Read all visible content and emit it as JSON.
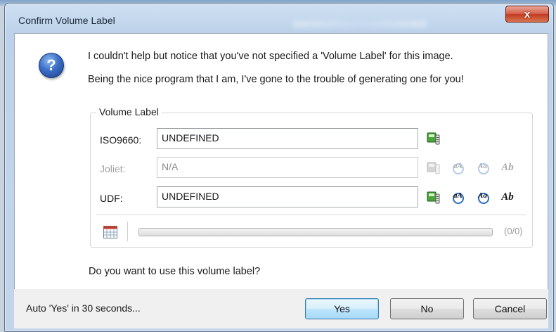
{
  "dialog": {
    "title": "Confirm Volume Label",
    "close_label": "x"
  },
  "message": {
    "line1": "I couldn't help but notice that you've not specified a 'Volume Label' for this image.",
    "line2": "Being the nice program that I am, I've gone to the trouble of generating one for you!"
  },
  "volume_group": {
    "label": "Volume Label",
    "iso9660": {
      "label": "ISO9660:",
      "value": "UNDEFINED",
      "enabled": true
    },
    "joliet": {
      "label": "Joliet:",
      "value": "N/A",
      "enabled": false
    },
    "udf": {
      "label": "UDF:",
      "value": "UNDEFINED",
      "enabled": true
    },
    "style_icons": [
      "lowercase-a-icon",
      "capital-a-icon",
      "ab-icon"
    ],
    "progress": {
      "text": "(0/0)",
      "fraction": 0
    }
  },
  "prompt": "Do you want to use this volume label?",
  "footer": {
    "auto_text": "Auto 'Yes' in 30 seconds...",
    "yes_label": "Yes",
    "no_label": "No",
    "cancel_label": "Cancel"
  },
  "colors": {
    "title_bar": "#c3d5ea",
    "close_button": "#c23a22",
    "default_button_border": "#3c7fb1",
    "question_icon": "#3a6fc8"
  }
}
